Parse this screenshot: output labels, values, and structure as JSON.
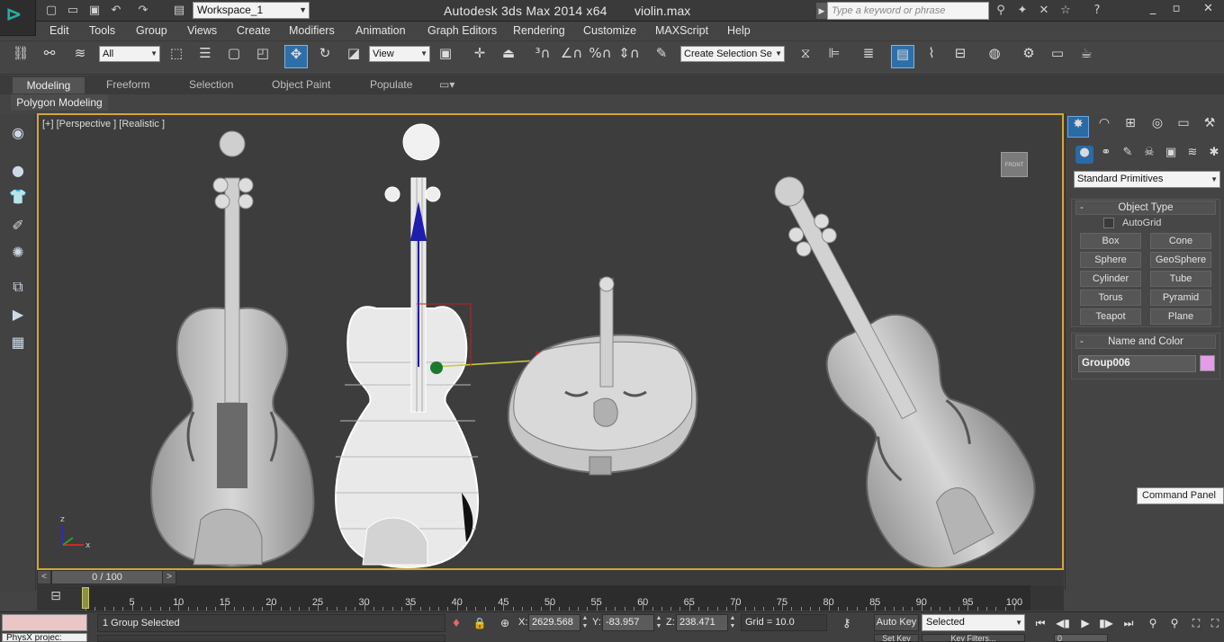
{
  "app": {
    "workspace": "Workspace_1",
    "title": "Autodesk 3ds Max  2014 x64",
    "file": "violin.max",
    "search_placeholder": "Type a keyword or phrase"
  },
  "menu": [
    "Edit",
    "Tools",
    "Group",
    "Views",
    "Create",
    "Modifiers",
    "Animation",
    "Graph Editors",
    "Rendering",
    "Customize",
    "MAXScript",
    "Help"
  ],
  "toolbar": {
    "filter": "All",
    "ref_coord": "View",
    "selection_set": "Create Selection Se"
  },
  "ribbon": {
    "tabs": [
      "Modeling",
      "Freeform",
      "Selection",
      "Object Paint",
      "Populate"
    ],
    "active_tab": "Modeling",
    "sub_tab": "Polygon Modeling"
  },
  "viewport": {
    "label": "[+] [Perspective ] [Realistic ]",
    "viewcube": "FRONT",
    "axis_x": "x",
    "axis_z": "z"
  },
  "command_panel": {
    "category": "Standard Primitives",
    "object_type": {
      "title": "Object Type",
      "autogrid": "AutoGrid",
      "buttons": [
        "Box",
        "Cone",
        "Sphere",
        "GeoSphere",
        "Cylinder",
        "Tube",
        "Torus",
        "Pyramid",
        "Teapot",
        "Plane"
      ]
    },
    "name_color": {
      "title": "Name and Color",
      "name": "Group006",
      "color": "#e49ce9"
    },
    "tooltip": "Command Panel"
  },
  "timeline": {
    "slider": "0 / 100",
    "ticks": [
      "0",
      "5",
      "10",
      "15",
      "20",
      "25",
      "30",
      "35",
      "40",
      "45",
      "50",
      "55",
      "60",
      "65",
      "70",
      "75",
      "80",
      "85",
      "90",
      "95",
      "100"
    ],
    "prev": "<",
    "next": ">"
  },
  "status": {
    "maxscript": "PhysX projec:",
    "message": "1 Group Selected",
    "x_label": "X:",
    "x": "2629.568",
    "y_label": "Y:",
    "y": "-83.957",
    "z_label": "Z:",
    "z": "238.471",
    "grid": "Grid = 10.0",
    "autokey": "Auto Key",
    "setkey_mode": "Selected",
    "setkey": "Set Key",
    "key_filters": "Key Filters...",
    "frame": "0"
  }
}
